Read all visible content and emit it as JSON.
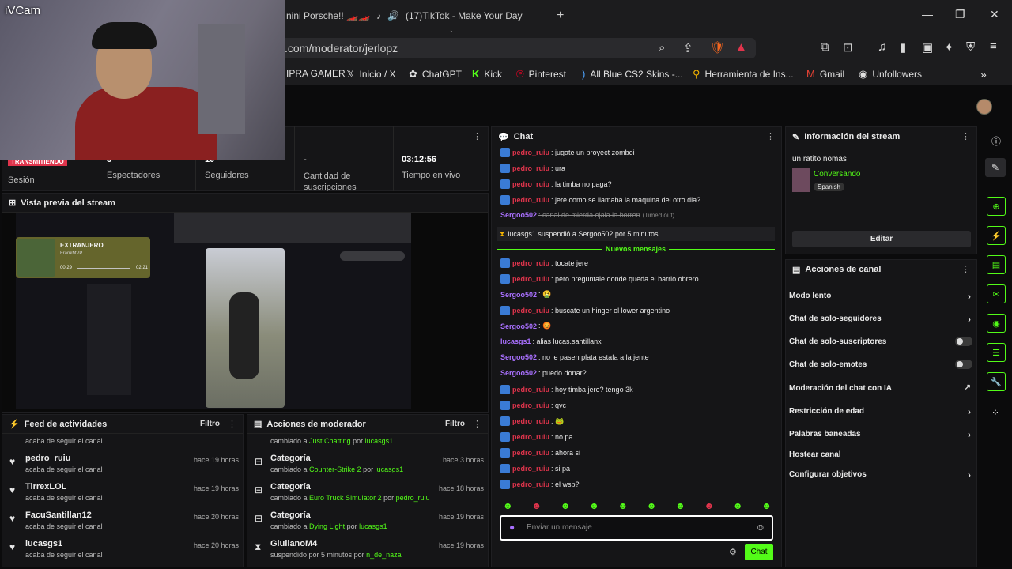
{
  "webcam_label": "iVCam",
  "tabs": [
    {
      "label": "nini Porsche!! 🏎️🏎️"
    },
    {
      "label": "(17)TikTok - Make Your Day"
    }
  ],
  "url": ".com/moderator/jerlopz",
  "bookmarks": [
    {
      "label": "IPRA GAMER",
      "icon": "bookmark-icon"
    },
    {
      "label": "Inicio / X",
      "icon": "x-icon"
    },
    {
      "label": "ChatGPT",
      "icon": "chatgpt-icon"
    },
    {
      "label": "Kick",
      "icon": "kick-icon"
    },
    {
      "label": "Pinterest",
      "icon": "pinterest-icon"
    },
    {
      "label": "All Blue CS2 Skins -...",
      "icon": "bookmark-icon"
    },
    {
      "label": "Herramienta de Ins...",
      "icon": "search-icon"
    },
    {
      "label": "Gmail",
      "icon": "gmail-icon"
    },
    {
      "label": "Unfollowers",
      "icon": "unfollowers-icon"
    }
  ],
  "stats": {
    "live_badge": "TRANSMITIENDO",
    "session_label": "Sesión",
    "viewers_value": "3",
    "viewers_label": "Espectadores",
    "followers_value": "10",
    "followers_label": "Seguidores",
    "subs_value": "-",
    "subs_label": "Cantidad de suscripciones",
    "uptime_value": "03:12:56",
    "uptime_label": "Tiempo en vivo"
  },
  "preview": {
    "title": "Vista previa del stream",
    "music_title": "EXTRANJERO",
    "music_artist": "FrankMVP",
    "music_elapsed": "00:29",
    "music_total": "02:21"
  },
  "feed": {
    "title": "Feed de actividades",
    "filter": "Filtro",
    "top_sub": "acaba de seguir el canal",
    "items": [
      {
        "name": "pedro_ruiu",
        "sub": "acaba de seguir el canal",
        "time": "hace 19 horas"
      },
      {
        "name": "TirrexLOL",
        "sub": "acaba de seguir el canal",
        "time": "hace 19 horas"
      },
      {
        "name": "FacuSantillan12",
        "sub": "acaba de seguir el canal",
        "time": "hace 20 horas"
      },
      {
        "name": "lucasgs1",
        "sub": "acaba de seguir el canal",
        "time": "hace 20 horas"
      }
    ]
  },
  "modactions": {
    "title": "Acciones de moderador",
    "filter": "Filtro",
    "top_prefix": "cambiado a",
    "top_target": "Just Chatting",
    "top_by": "por",
    "top_user": "lucasgs1",
    "items": [
      {
        "title": "Categoría",
        "prefix": "cambiado a",
        "target": "Counter-Strike 2",
        "by": "por",
        "user": "lucasgs1",
        "time": "hace 3 horas",
        "icon": "category-icon"
      },
      {
        "title": "Categoría",
        "prefix": "cambiado a",
        "target": "Euro Truck Simulator 2",
        "by": "por",
        "user": "pedro_ruiu",
        "time": "hace 18 horas",
        "icon": "category-icon"
      },
      {
        "title": "Categoría",
        "prefix": "cambiado a",
        "target": "Dying Light",
        "by": "por",
        "user": "lucasgs1",
        "time": "hace 19 horas",
        "icon": "category-icon"
      },
      {
        "title": "GiulianoM4",
        "prefix": "suspendido por 5 minutos",
        "target": "",
        "by": "por",
        "user": "n_de_naza",
        "time": "hace 19 horas",
        "icon": "hourglass-icon"
      }
    ]
  },
  "chat": {
    "title": "Chat",
    "new_messages": "Nuevos mensajes",
    "input_placeholder": "Enviar un mensaje",
    "send_label": "Chat",
    "messages": [
      {
        "user": "pedro_ruiu",
        "text": ": jugate un proyect zomboi",
        "color": "red"
      },
      {
        "user": "pedro_ruiu",
        "text": ": ura",
        "color": "red"
      },
      {
        "user": "pedro_ruiu",
        "text": ": la timba no paga?",
        "color": "red"
      },
      {
        "user": "pedro_ruiu",
        "text": ": jere como se llamaba la maquina del otro dia?",
        "color": "red"
      },
      {
        "user": "Sergoo502",
        "text": ": canal de mierda ojala lo borren",
        "color": "purple",
        "note": "(Timed out)"
      },
      {
        "system": "lucasgs1 suspendió a Sergoo502 por 5 minutos"
      },
      {
        "divider": true
      },
      {
        "user": "pedro_ruiu",
        "text": ": tocate jere",
        "color": "red"
      },
      {
        "user": "pedro_ruiu",
        "text": ": pero preguntale donde queda el barrio obrero",
        "color": "red"
      },
      {
        "user": "Sergoo502",
        "text": ": 🤮",
        "color": "purple"
      },
      {
        "user": "pedro_ruiu",
        "text": ": buscate un hinger ol lower argentino",
        "color": "red"
      },
      {
        "user": "Sergoo502",
        "text": ": 😡",
        "color": "purple"
      },
      {
        "user": "lucasgs1",
        "text": ": alias lucas.santillanx",
        "color": "purple"
      },
      {
        "user": "Sergoo502",
        "text": ": no le pasen plata estafa a la jente",
        "color": "purple"
      },
      {
        "user": "Sergoo502",
        "text": ": puedo donar?",
        "color": "purple"
      },
      {
        "user": "pedro_ruiu",
        "text": ": hoy timba jere? tengo 3k",
        "color": "red"
      },
      {
        "user": "pedro_ruiu",
        "text": ": qvc",
        "color": "red"
      },
      {
        "user": "pedro_ruiu",
        "text": ": 🐸",
        "color": "red"
      },
      {
        "user": "pedro_ruiu",
        "text": ": no pa",
        "color": "red"
      },
      {
        "user": "pedro_ruiu",
        "text": ": ahora si",
        "color": "red"
      },
      {
        "user": "pedro_ruiu",
        "text": ": si pa",
        "color": "red"
      },
      {
        "user": "pedro_ruiu",
        "text": ": el wsp?",
        "color": "red"
      }
    ]
  },
  "stream_info": {
    "title": "Información del stream",
    "stream_title": "un ratito nomas",
    "category": "Conversando",
    "language": "Spanish",
    "edit_label": "Editar"
  },
  "channel_actions": {
    "title": "Acciones de canal",
    "items": [
      {
        "label": "Modo lento",
        "control": "chevron"
      },
      {
        "label": "Chat de solo-seguidores",
        "control": "chevron"
      },
      {
        "label": "Chat de solo-suscriptores",
        "control": "toggle"
      },
      {
        "label": "Chat de solo-emotes",
        "control": "toggle"
      },
      {
        "label": "Moderación del chat con IA",
        "control": "external"
      },
      {
        "label": "Restricción de edad",
        "control": "chevron"
      },
      {
        "label": "Palabras baneadas",
        "control": "chevron"
      },
      {
        "label": "Hostear canal",
        "control": "none"
      },
      {
        "label": "Configurar objetivos",
        "control": "chevron"
      }
    ]
  },
  "colors": {
    "kick_green": "#53fc18",
    "user_red": "#e0344c",
    "user_purple": "#a970ff",
    "panel_bg": "#151517"
  }
}
